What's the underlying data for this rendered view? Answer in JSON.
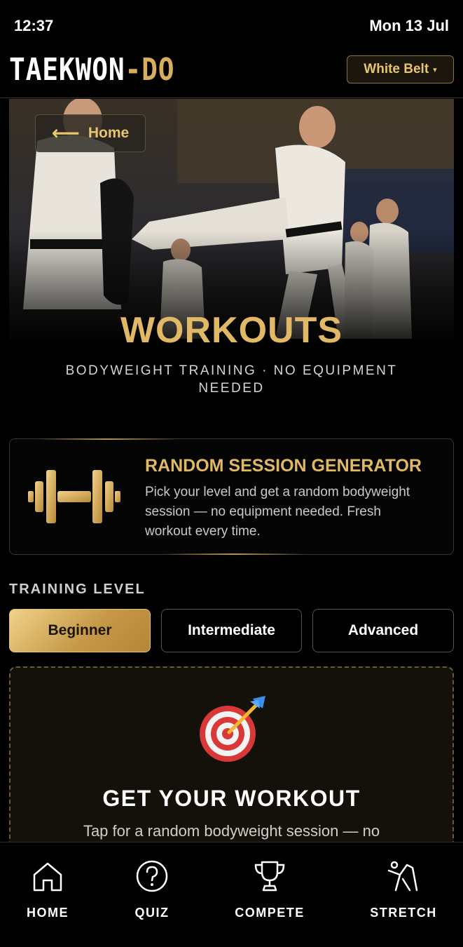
{
  "status": {
    "time": "12:37",
    "date": "Mon 13 Jul"
  },
  "header": {
    "logo_part1": "TAEKWON",
    "logo_part2": "-DO",
    "belt_label": "White Belt",
    "belt_caret": "▾"
  },
  "hero": {
    "back_arrow": "⟵",
    "back_label": "Home",
    "title": "WORKOUTS",
    "subtitle": "BODYWEIGHT TRAINING · NO EQUIPMENT NEEDED"
  },
  "generator": {
    "icon": "dumbbell-icon",
    "title": "RANDOM SESSION GENERATOR",
    "description": "Pick your level and get a random bodyweight session — no equipment needed. Fresh workout every time."
  },
  "training_level": {
    "label": "TRAINING LEVEL",
    "options": [
      "Beginner",
      "Intermediate",
      "Advanced"
    ],
    "selected": "Beginner"
  },
  "workout": {
    "icon": "target-dart-icon",
    "title": "GET YOUR WORKOUT",
    "description": "Tap for a random bodyweight session — no"
  },
  "nav": [
    {
      "label": "HOME",
      "icon": "home-icon"
    },
    {
      "label": "QUIZ",
      "icon": "question-icon"
    },
    {
      "label": "COMPETE",
      "icon": "trophy-icon"
    },
    {
      "label": "STRETCH",
      "icon": "stretch-icon"
    }
  ],
  "colors": {
    "gold": "#e0b866",
    "background": "#000000",
    "card": "#14110b"
  }
}
